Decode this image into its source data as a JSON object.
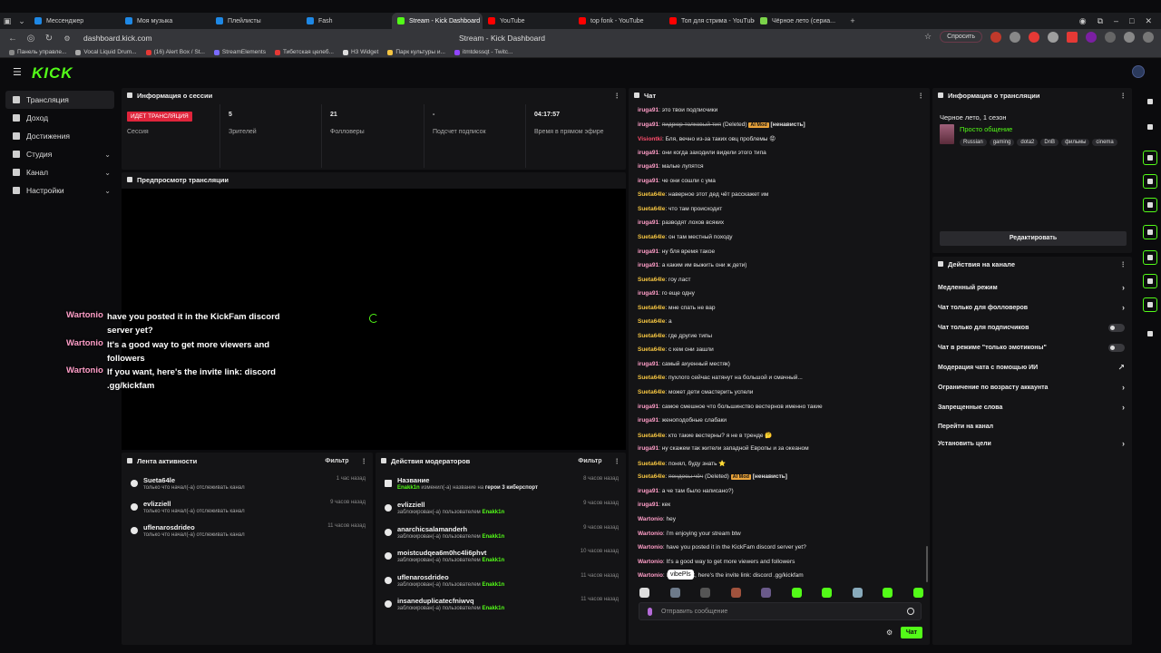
{
  "browser": {
    "tabs": [
      {
        "label": "Мессенджер",
        "color": "#1e88e5"
      },
      {
        "label": "Моя музыка",
        "color": "#1e88e5"
      },
      {
        "label": "Плейлисты",
        "color": "#1e88e5"
      },
      {
        "label": "Fash",
        "color": "#1e88e5"
      },
      {
        "label": "Stream - Kick Dashboard",
        "color": "#53fc18",
        "active": true
      },
      {
        "label": "YouTube",
        "color": "#ff0000"
      },
      {
        "label": "top fonk - YouTube",
        "color": "#ff0000"
      },
      {
        "label": "Топ для стрима - YouTube",
        "color": "#ff0000"
      },
      {
        "label": "Чёрное лето (сериа...",
        "color": "#7bd34a"
      }
    ],
    "url": "dashboard.kick.com",
    "page_title": "Stream - Kick Dashboard",
    "ask_label": "Спросить",
    "bookmarks": [
      "Панель управле...",
      "Vocal Liquid Drum...",
      "(16) Alert Box / St...",
      "StreamElements",
      "Тибетская целеб...",
      "H3 Widget",
      "Парк культуры и...",
      "itmtdessqt - Twitc..."
    ]
  },
  "app": {
    "logo": "KICK"
  },
  "sidebar": {
    "items": [
      {
        "label": "Трансляция",
        "active": true
      },
      {
        "label": "Доход"
      },
      {
        "label": "Достижения"
      },
      {
        "label": "Студия",
        "chevron": true
      },
      {
        "label": "Канал",
        "chevron": true
      },
      {
        "label": "Настройки",
        "chevron": true
      }
    ]
  },
  "session": {
    "title": "Информация о сессии",
    "live_badge": "ИДЕТ ТРАНСЛЯЦИЯ",
    "session_label": "Сессия",
    "viewers_value": "5",
    "viewers_label": "Зрителей",
    "followers_value": "21",
    "followers_label": "Фолловеры",
    "subs_value": "-",
    "subs_label": "Подсчет подписок",
    "uptime_value": "04:17:57",
    "uptime_label": "Время в прямом эфире"
  },
  "preview": {
    "title": "Предпросмотр трансляции",
    "overlay": [
      {
        "user": "Wartonio",
        "msg": "have you posted it in the KickFam discord server yet?"
      },
      {
        "user": "Wartonio",
        "msg": "It's a good way to get more viewers and followers"
      },
      {
        "user": "Wartonio",
        "msg": "If you want, here's the invite link: discord .gg/kickfam"
      }
    ]
  },
  "activity": {
    "title": "Лента активности",
    "filter": "Фильтр",
    "rows": [
      {
        "name": "Sueta64le",
        "sub": "только что начал(-а) отслеживать канал",
        "time": "1 час назад"
      },
      {
        "name": "evlizziell",
        "sub": "только что начал(-а) отслеживать канал",
        "time": "9 часов назад"
      },
      {
        "name": "uflenarosdrideo",
        "sub": "только что начал(-а) отслеживать канал",
        "time": "11 часов назад"
      }
    ]
  },
  "mod": {
    "title": "Действия модераторов",
    "filter": "Фильтр",
    "first": {
      "name": "Название",
      "user": "Enakk1n",
      "mid": "изменил(-а) название на",
      "value": "герои 3 киберспорт",
      "time": "8 часов назад"
    },
    "blocked_text": "заблокирован(-а) пользователем",
    "blocked_by": "Enakk1n",
    "rows": [
      {
        "name": "evlizziell",
        "time": "9 часов назад"
      },
      {
        "name": "anarchicsalamanderh",
        "time": "9 часов назад"
      },
      {
        "name": "moistcudqea6m0hc4li6phvt",
        "time": "10 часов назад"
      },
      {
        "name": "uflenarosdrideo",
        "time": "11 часов назад"
      },
      {
        "name": "insaneduplicatecfniwvq",
        "time": "11 часов назад"
      }
    ]
  },
  "chat": {
    "title": "Чат",
    "messages": [
      {
        "user": "iruga91",
        "color": "#ff9ec8",
        "text": "это твои подписчики"
      },
      {
        "user": "iruga91",
        "color": "#ff9ec8",
        "deleted": "пидрюр толковый тип",
        "ai": "AI Mod",
        "tag": "[ненависть]"
      },
      {
        "user": "Visiontki",
        "color": "#ff4d6d",
        "text": "Бля, вечно из-за таких овц проблемы 😡"
      },
      {
        "user": "iruga91",
        "color": "#ff9ec8",
        "text": "они когда заходили видели этого типа"
      },
      {
        "user": "iruga91",
        "color": "#ff9ec8",
        "text": "малые лупятся"
      },
      {
        "user": "iruga91",
        "color": "#ff9ec8",
        "text": "че они сошли с ума"
      },
      {
        "user": "Sueta64le",
        "color": "#f5c542",
        "text": "наверное этот дед чёт расскажет им"
      },
      {
        "user": "Sueta64le",
        "color": "#f5c542",
        "text": "что там происходит"
      },
      {
        "user": "iruga91",
        "color": "#ff9ec8",
        "text": "разводят лохов всяких"
      },
      {
        "user": "Sueta64le",
        "color": "#f5c542",
        "text": "он там местный походу"
      },
      {
        "user": "iruga91",
        "color": "#ff9ec8",
        "text": "ну бля время такое"
      },
      {
        "user": "iruga91",
        "color": "#ff9ec8",
        "text": "а каким им выжить они ж дети)"
      },
      {
        "user": "Sueta64le",
        "color": "#f5c542",
        "text": "гоу ласт"
      },
      {
        "user": "iruga91",
        "color": "#ff9ec8",
        "text": "го еще одну"
      },
      {
        "user": "Sueta64le",
        "color": "#f5c542",
        "text": "мне спать не вар"
      },
      {
        "user": "Sueta64le",
        "color": "#f5c542",
        "text": "а"
      },
      {
        "user": "Sueta64le",
        "color": "#f5c542",
        "text": "где другие типы"
      },
      {
        "user": "Sueta64le",
        "color": "#f5c542",
        "text": "с кем они зашли"
      },
      {
        "user": "iruga91",
        "color": "#ff9ec8",
        "text": "самый ахуенный местяк)"
      },
      {
        "user": "Sueta64le",
        "color": "#f5c542",
        "text": "пухлого сейчас натянут на большой и смачный..."
      },
      {
        "user": "Sueta64le",
        "color": "#f5c542",
        "text": "может дети смастерить успели"
      },
      {
        "user": "iruga91",
        "color": "#ff9ec8",
        "text": "самое смешное что большинство вестернов именно такие"
      },
      {
        "user": "iruga91",
        "color": "#ff9ec8",
        "text": "женоподобные слабаки"
      },
      {
        "user": "Sueta64le",
        "color": "#f5c542",
        "text": "кто такие вестерны? я не в тренде 🤔"
      },
      {
        "user": "iruga91",
        "color": "#ff9ec8",
        "text": "ну скажем так жители западной Европы и за океаном"
      },
      {
        "user": "Sueta64le",
        "color": "#f5c542",
        "text": "понял, буду знать ⭐"
      },
      {
        "user": "Sueta64le",
        "color": "#f5c542",
        "deleted": "пендосы чёч",
        "ai": "AI Mod",
        "tag": "[ненависть]"
      },
      {
        "user": "iruga91",
        "color": "#ff9ec8",
        "text": "а че там было написано?)"
      },
      {
        "user": "iruga91",
        "color": "#ff9ec8",
        "text": "кек"
      },
      {
        "user": "Wartonio",
        "color": "#ff9ec8",
        "text": "hey"
      },
      {
        "user": "Wartonio",
        "color": "#ff9ec8",
        "text": "i'm enjoying your stream btw"
      },
      {
        "user": "Wartonio",
        "color": "#ff9ec8",
        "text": "have you posted it in the KickFam discord server yet?"
      },
      {
        "user": "Wartonio",
        "color": "#ff9ec8",
        "text": "It's a good way to get more viewers and followers"
      },
      {
        "user": "Wartonio",
        "color": "#ff9ec8",
        "text": "If you want, here's the invite link: discord .gg/kickfam"
      }
    ],
    "tooltip": "vibePls",
    "input_placeholder": "Отправить сообщение",
    "send_label": "Чат"
  },
  "stream_info": {
    "title": "Информация о трансляции",
    "stream_title": "Черное лето, 1 сезон",
    "category": "Просто общение",
    "tags": [
      "Russian",
      "gaming",
      "dota2",
      "DnB",
      "фильмы",
      "cinema"
    ],
    "edit_label": "Редактировать"
  },
  "channel_actions": {
    "title": "Действия на канале",
    "items": [
      {
        "label": "Медленный режим",
        "control": "chevron"
      },
      {
        "label": "Чат только для фолловеров",
        "control": "chevron"
      },
      {
        "label": "Чат только для подписчиков",
        "control": "toggle"
      },
      {
        "label": "Чат в режиме \"только эмотиконы\"",
        "control": "toggle"
      },
      {
        "label": "Модерация чата с помощью ИИ",
        "control": "external"
      },
      {
        "label": "Ограничение по возрасту аккаунта",
        "control": "chevron"
      },
      {
        "label": "Запрещенные слова",
        "control": "chevron"
      },
      {
        "label": "Перейти на канал",
        "control": "none"
      },
      {
        "label": "Установить цели",
        "control": "chevron"
      }
    ]
  },
  "colors": {
    "accent": "#53fc18",
    "live": "#e0243b",
    "ai_mod": "#e8a23a"
  }
}
